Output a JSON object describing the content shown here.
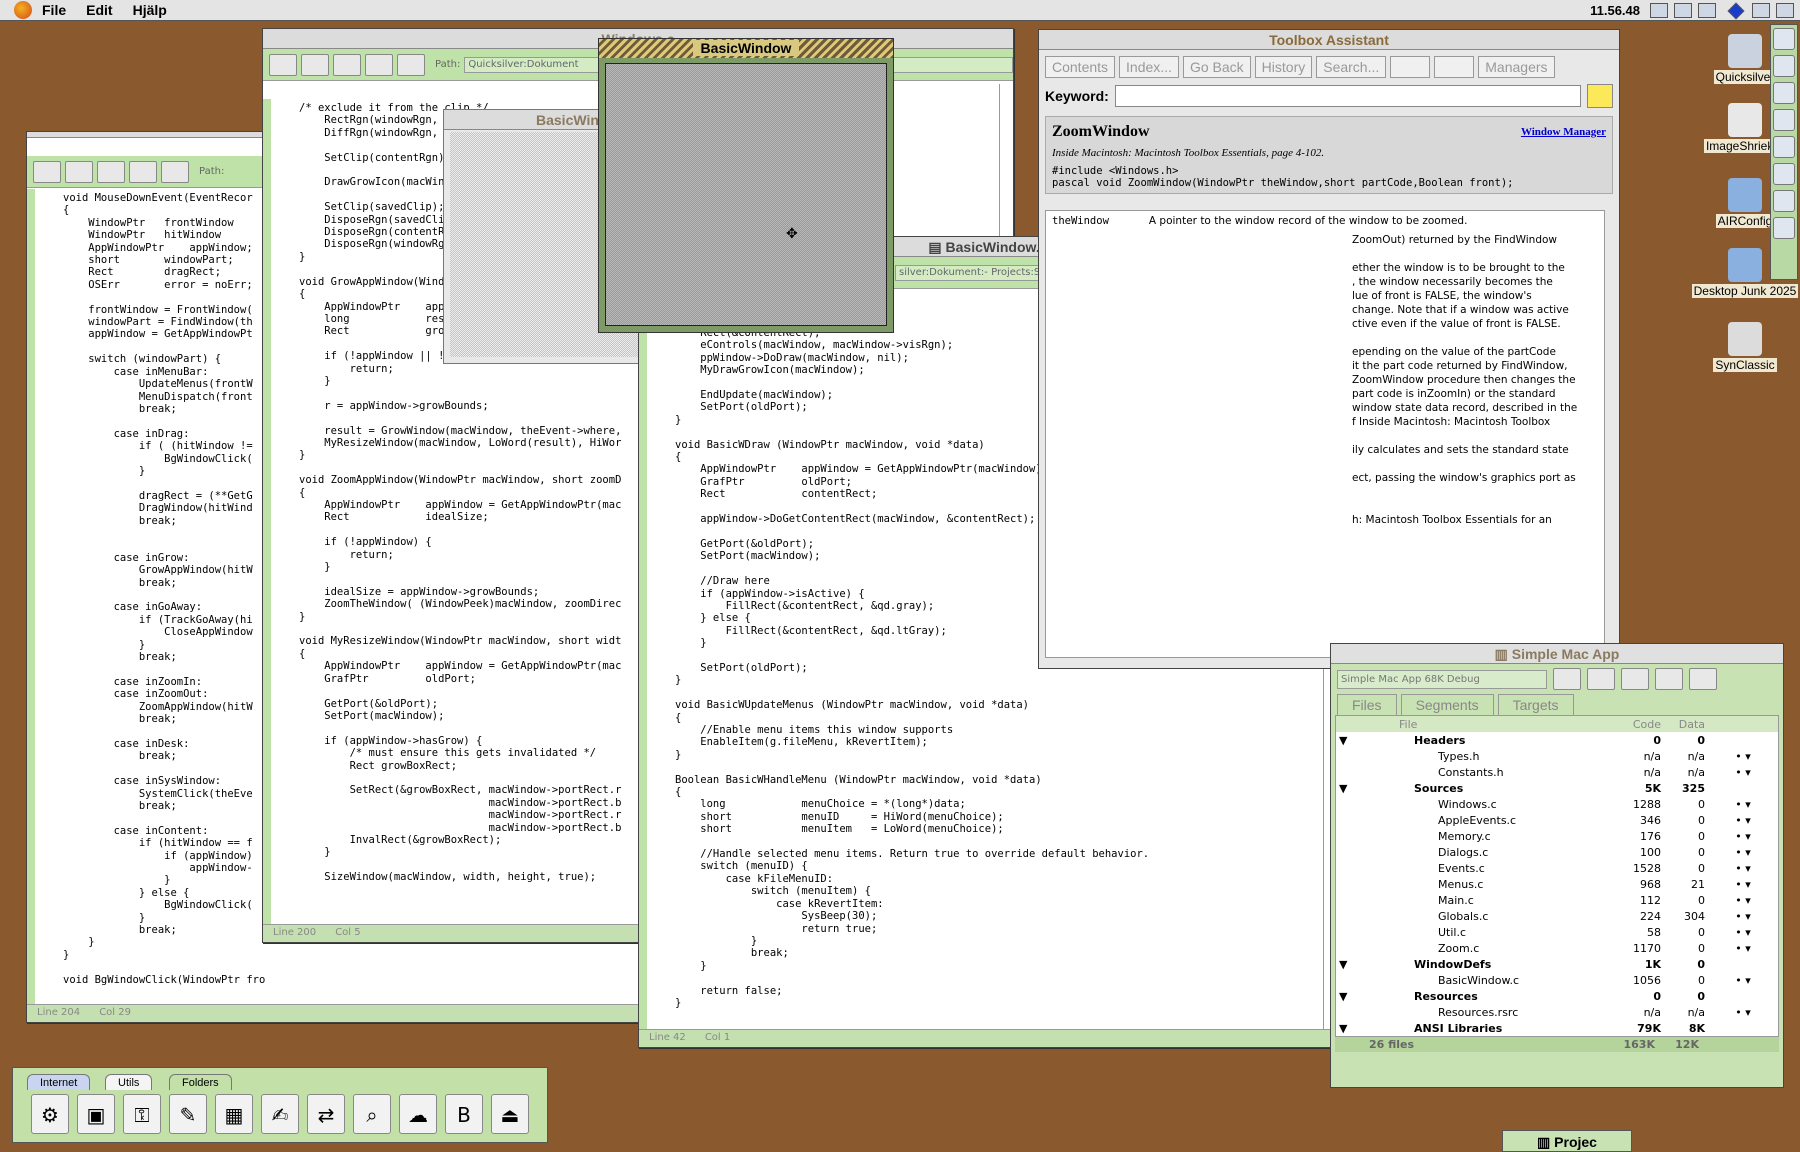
{
  "menubar": {
    "menus": [
      "File",
      "Edit",
      "Hjälp"
    ],
    "clock": "11.56.48"
  },
  "win_left": {
    "path_label": "Path:",
    "status_line": "Line 204",
    "status_col": "Col 29",
    "code": "void MouseDownEvent(EventRecor\n{\n    WindowPtr   frontWindow\n    WindowPtr   hitWindow\n    AppWindowPtr    appWindow;\n    short       windowPart;\n    Rect        dragRect;\n    OSErr       error = noErr;\n\n    frontWindow = FrontWindow(\n    windowPart = FindWindow(th\n    appWindow = GetAppWindowPt\n\n    switch (windowPart) {\n        case inMenuBar:\n            UpdateMenus(frontW\n            MenuDispatch(front\n            break;\n\n        case inDrag:\n            if ( (hitWindow !=\n                BgWindowClick(\n            }\n\n            dragRect = (**GetG\n            DragWindow(hitWind\n            break;\n\n\n        case inGrow:\n            GrowAppWindow(hitW\n            break;\n\n        case inGoAway:\n            if (TrackGoAway(hi\n                CloseAppWindow\n            }\n            break;\n\n        case inZoomIn:\n        case inZoomOut:\n            ZoomAppWindow(hitW\n            break;\n\n        case inDesk:\n            break;\n\n        case inSysWindow:\n            SystemClick(theEve\n            break;\n\n        case inContent:\n            if (hitWindow == f\n                if (appWindow)\n                    appWindow-\n                }\n            } else {\n                BgWindowClick(\n            }\n            break;\n    }\n}\n\nvoid BgWindowClick(WindowPtr frontWindow, WindowPtr hitWindow)"
  },
  "win_windows": {
    "title": "Windows.c",
    "path_label": "Path:",
    "path_value": "Quicksilver:Dokument",
    "status_line": "Line 200",
    "status_col": "Col 5",
    "code": "/* exclude it from the clip */\n    RectRgn(windowRgn,\n    DiffRgn(windowRgn,\n\n    SetClip(contentRgn)\n\n    DrawGrowIcon(macWin\n\n    SetClip(savedClip);\n    DisposeRgn(savedCli\n    DisposeRgn(contentR\n    DisposeRgn(windowRg\n}\n\nvoid GrowAppWindow(Wind\n{\n    AppWindowPtr    app\n    long            res\n    Rect            gro\n\n    if (!appWindow || !\n        return;\n    }\n\n    r = appWindow->growBounds;\n\n    result = GrowWindow(macWindow, theEvent->where,\n    MyResizeWindow(macWindow, LoWord(result), HiWor\n}\n\nvoid ZoomAppWindow(WindowPtr macWindow, short zoomD\n{\n    AppWindowPtr    appWindow = GetAppWindowPtr(mac\n    Rect            idealSize;\n\n    if (!appWindow) {\n        return;\n    }\n\n    idealSize = appWindow->growBounds;\n    ZoomTheWindow( (WindowPeek)macWindow, zoomDirec\n}\n\nvoid MyResizeWindow(WindowPtr macWindow, short widt\n{\n    AppWindowPtr    appWindow = GetAppWindowPtr(mac\n    GrafPtr         oldPort;\n\n    GetPort(&oldPort);\n    SetPort(macWindow);\n\n    if (appWindow->hasGrow) {\n        /* must ensure this gets invalidated */\n        Rect growBoxRect;\n\n        SetRect(&growBoxRect, macWindow->portRect.r\n                              macWindow->portRect.b\n                              macWindow->portRect.r\n                              macWindow->portRect.b\n        InvalRect(&growBoxRect);\n    }\n\n    SizeWindow(macWindow, width, height, true);"
  },
  "win_basicwindow_c": {
    "title": "BasicWindow.c",
    "path_value": "silver:Dokument:- Projects:Simple Mac App:Sources:BasicWindow.c",
    "status_line": "Line 42",
    "status_col": "Col 1",
    "code": "    Rect(&contentRect);\n    eControls(macWindow, macWindow->visRgn);\n    ppWindow->DoDraw(macWindow, nil);\n    MyDrawGrowIcon(macWindow);\n\n    EndUpdate(macWindow);\n    SetPort(oldPort);\n}\n\nvoid BasicWDraw (WindowPtr macWindow, void *data)\n{\n    AppWindowPtr    appWindow = GetAppWindowPtr(macWindow);\n    GrafPtr         oldPort;\n    Rect            contentRect;\n\n    appWindow->DoGetContentRect(macWindow, &contentRect);\n\n    GetPort(&oldPort);\n    SetPort(macWindow);\n\n    //Draw here\n    if (appWindow->isActive) {\n        FillRect(&contentRect, &qd.gray);\n    } else {\n        FillRect(&contentRect, &qd.ltGray);\n    }\n\n    SetPort(oldPort);\n}\n\nvoid BasicWUpdateMenus (WindowPtr macWindow, void *data)\n{\n    //Enable menu items this window supports\n    EnableItem(g.fileMenu, kRevertItem);\n}\n\nBoolean BasicWHandleMenu (WindowPtr macWindow, void *data)\n{\n    long            menuChoice = *(long*)data;\n    short           menuID     = HiWord(menuChoice);\n    short           menuItem   = LoWord(menuChoice);\n\n    //Handle selected menu items. Return true to override default behavior.\n    switch (menuID) {\n        case kFileMenuID:\n            switch (menuItem) {\n                case kRevertItem:\n                    SysBeep(30);\n                    return true;\n            }\n            break;\n    }\n\n    return false;\n}"
  },
  "basic_window_small": {
    "title": "BasicWindow"
  },
  "basic_window_active": {
    "title": "BasicWindow"
  },
  "toolbox": {
    "title": "Toolbox Assistant",
    "buttons": [
      "Contents",
      "Index...",
      "Go Back",
      "History",
      "Search...",
      "Managers"
    ],
    "keyword_label": "Keyword:",
    "heading": "ZoomWindow",
    "manager_link": "Window Manager",
    "source": "Inside Macintosh: Macintosh Toolbox Essentials, page 4-102.",
    "decl1": "#include <Windows.h>",
    "decl2": "pascal void ZoomWindow(WindowPtr theWindow,short partCode,Boolean front);",
    "param_name": "theWindow",
    "param_desc": "A pointer to the window record of the window to be zoomed.",
    "body_lines": [
      "ZoomOut) returned by the FindWindow",
      "",
      "ether the window is to be brought to the",
      ", the window necessarily becomes the",
      "lue of front is FALSE, the window's",
      "change. Note that if a window was active",
      "ctive even if the value of front is FALSE.",
      "",
      "epending on the value of the partCode",
      " it the part code returned by FindWindow,",
      "ZoomWindow procedure then changes the",
      "part code is inZoomIn) or the standard",
      "window state data record, described in the",
      "f Inside Macintosh: Macintosh Toolbox",
      "",
      "ily calculates and sets the standard state",
      "",
      "ect, passing the window's graphics port as",
      "",
      "",
      "h: Macintosh Toolbox Essentials for an"
    ]
  },
  "project": {
    "title": "Simple Mac App",
    "target": "Simple Mac App 68K Debug",
    "tabs": [
      "Files",
      "Segments",
      "Targets"
    ],
    "col_file": "File",
    "col_code": "Code",
    "col_data": "Data",
    "rows": [
      {
        "name": "Headers",
        "code": "0",
        "data": "0",
        "group": true
      },
      {
        "name": "Types.h",
        "code": "n/a",
        "data": "n/a"
      },
      {
        "name": "Constants.h",
        "code": "n/a",
        "data": "n/a"
      },
      {
        "name": "Sources",
        "code": "5K",
        "data": "325",
        "group": true
      },
      {
        "name": "Windows.c",
        "code": "1288",
        "data": "0"
      },
      {
        "name": "AppleEvents.c",
        "code": "346",
        "data": "0"
      },
      {
        "name": "Memory.c",
        "code": "176",
        "data": "0"
      },
      {
        "name": "Dialogs.c",
        "code": "100",
        "data": "0"
      },
      {
        "name": "Events.c",
        "code": "1528",
        "data": "0"
      },
      {
        "name": "Menus.c",
        "code": "968",
        "data": "21"
      },
      {
        "name": "Main.c",
        "code": "112",
        "data": "0"
      },
      {
        "name": "Globals.c",
        "code": "224",
        "data": "304"
      },
      {
        "name": "Util.c",
        "code": "58",
        "data": "0"
      },
      {
        "name": "Zoom.c",
        "code": "1170",
        "data": "0"
      },
      {
        "name": "WindowDefs",
        "code": "1K",
        "data": "0",
        "group": true
      },
      {
        "name": "BasicWindow.c",
        "code": "1056",
        "data": "0"
      },
      {
        "name": "Resources",
        "code": "0",
        "data": "0",
        "group": true
      },
      {
        "name": "Resources.rsrc",
        "code": "n/a",
        "data": "n/a"
      },
      {
        "name": "ANSI Libraries",
        "code": "79K",
        "data": "8K",
        "group": true
      }
    ],
    "footer_files": "26 files",
    "footer_code": "163K",
    "footer_data": "12K"
  },
  "desktop": {
    "icons": [
      "Quicksilver",
      "ImageShrieker",
      "AIRConfig",
      "Desktop Junk 2025",
      "SynClassic"
    ]
  },
  "launcher": {
    "tabs": [
      "Internet",
      "Utils",
      "Folders"
    ]
  },
  "project_tab": "Projec"
}
